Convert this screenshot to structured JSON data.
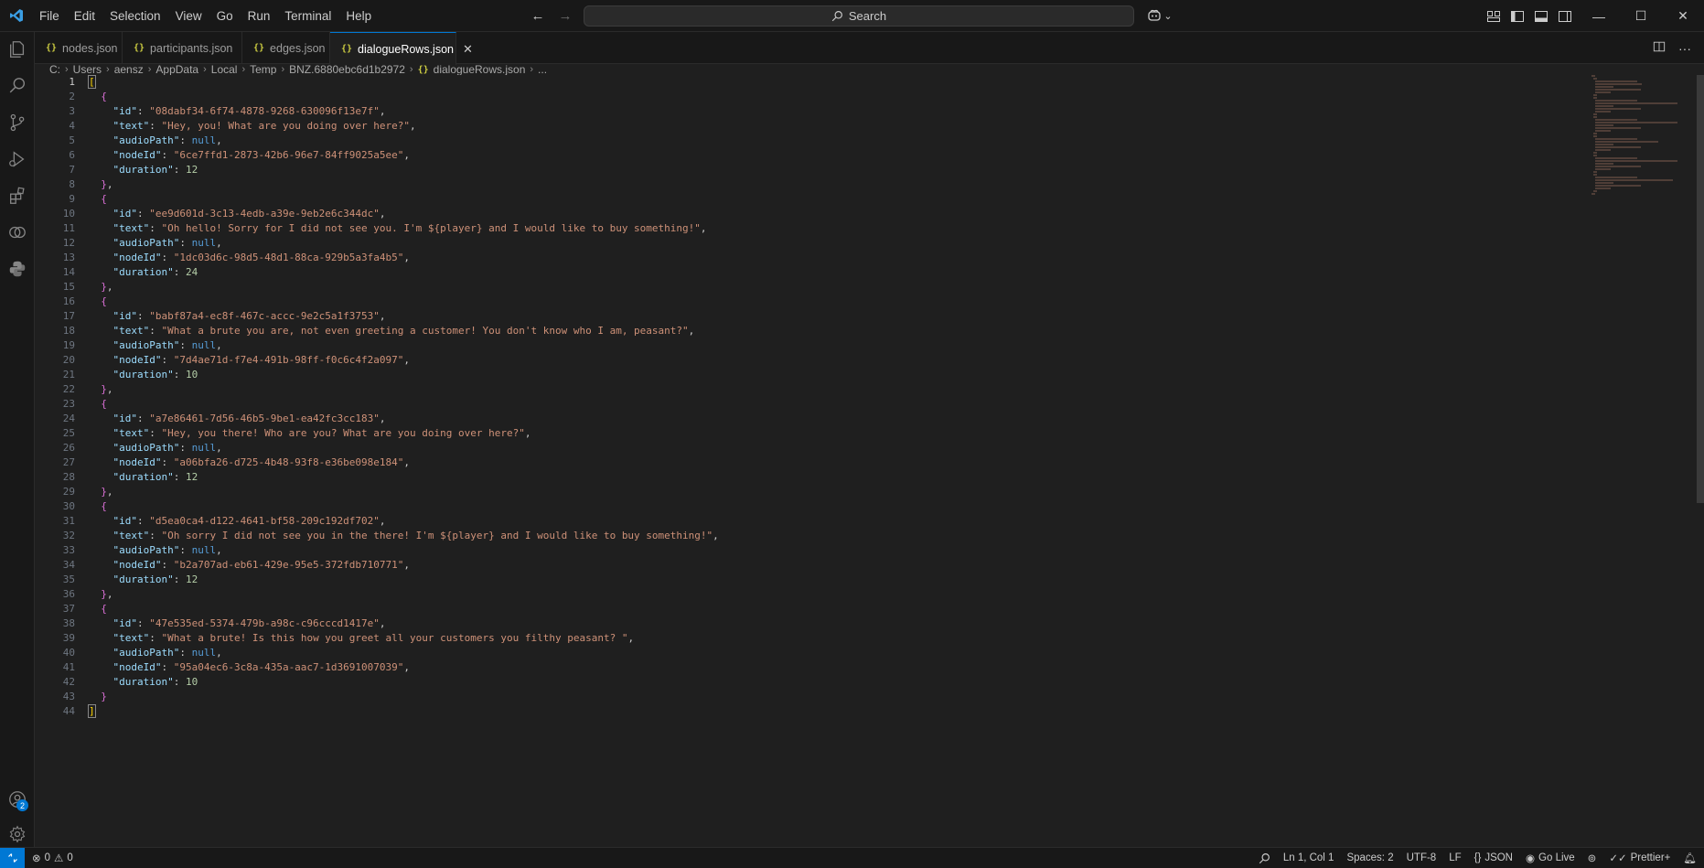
{
  "menu": [
    "File",
    "Edit",
    "Selection",
    "View",
    "Go",
    "Run",
    "Terminal",
    "Help"
  ],
  "search": {
    "label": "Search"
  },
  "tabs": [
    {
      "label": "nodes.json",
      "icon": "{}"
    },
    {
      "label": "participants.json",
      "icon": "{}"
    },
    {
      "label": "edges.json",
      "icon": "{}"
    },
    {
      "label": "dialogueRows.json",
      "icon": "{}",
      "active": true
    }
  ],
  "breadcrumb": [
    "C:",
    "Users",
    "aensz",
    "AppData",
    "Local",
    "Temp",
    "BNZ.6880ebc6d1b2972",
    "dialogueRows.json",
    "..."
  ],
  "editor": {
    "rows": [
      {
        "id": "08dabf34-6f74-4878-9268-630096f13e7f",
        "text": "Hey, you! What are you doing over here?",
        "audioPath": "null",
        "nodeId": "6ce7ffd1-2873-42b6-96e7-84ff9025a5ee",
        "duration": "12"
      },
      {
        "id": "ee9d601d-3c13-4edb-a39e-9eb2e6c344dc",
        "text": "Oh hello! Sorry for I did not see you. I'm ${player} and I would like to buy something!",
        "audioPath": "null",
        "nodeId": "1dc03d6c-98d5-48d1-88ca-929b5a3fa4b5",
        "duration": "24"
      },
      {
        "id": "babf87a4-ec8f-467c-accc-9e2c5a1f3753",
        "text": "What a brute you are, not even greeting a customer! You don't know who I am, peasant?",
        "audioPath": "null",
        "nodeId": "7d4ae71d-f7e4-491b-98ff-f0c6c4f2a097",
        "duration": "10"
      },
      {
        "id": "a7e86461-7d56-46b5-9be1-ea42fc3cc183",
        "text": "Hey, you there! Who are you? What are you doing over here?",
        "audioPath": "null",
        "nodeId": "a06bfa26-d725-4b48-93f8-e36be098e184",
        "duration": "12"
      },
      {
        "id": "d5ea0ca4-d122-4641-bf58-209c192df702",
        "text": "Oh sorry I did not see you in the there! I'm ${player} and I would like to buy something!",
        "audioPath": "null",
        "nodeId": "b2a707ad-eb61-429e-95e5-372fdb710771",
        "duration": "12"
      },
      {
        "id": "47e535ed-5374-479b-a98c-c96cccd1417e",
        "text": "What a brute! Is this how you greet all your customers you filthy peasant? ",
        "audioPath": "null",
        "nodeId": "95a04ec6-3c8a-435a-aac7-1d3691007039",
        "duration": "10"
      }
    ],
    "line_count": 44,
    "current_line": 1
  },
  "status": {
    "errors": "0",
    "warnings": "0",
    "position": "Ln 1, Col 1",
    "spaces": "Spaces: 2",
    "encoding": "UTF-8",
    "eol": "LF",
    "language": "JSON",
    "golive": "Go Live",
    "prettier": "Prettier+",
    "accounts_badge": "2"
  }
}
